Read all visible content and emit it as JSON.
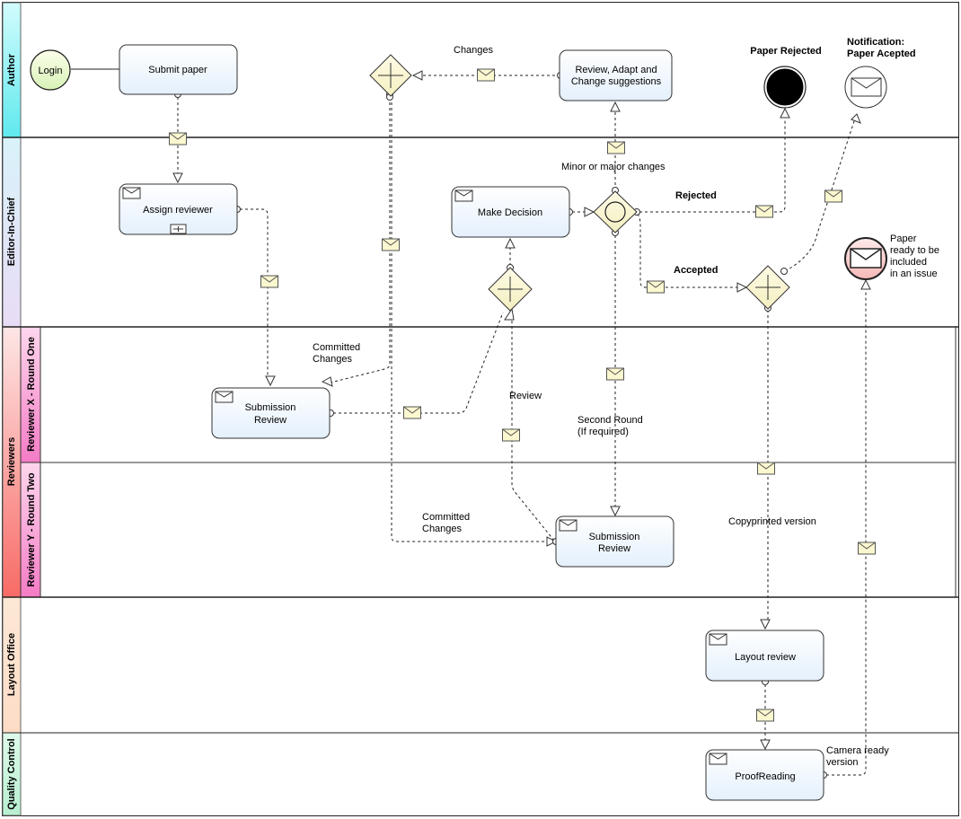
{
  "lanes": {
    "author": "Author",
    "editor": "Editor-In-Chief",
    "reviewers": "Reviewers",
    "reviewer_x": "Reviewer X - Round One",
    "reviewer_y": "Reviewer Y - Round Two",
    "layout": "Layout Office",
    "quality": "Quality Control"
  },
  "lane_colors": {
    "author": "#7ff0f3",
    "editor": "#e6dcf5",
    "reviewers": "#fa7d78",
    "reviewer_sub": "#f78fd0",
    "layout": "#fde3cf",
    "quality": "#c6f5dc"
  },
  "events": {
    "login": "Login",
    "paper_rejected": "Paper Rejected",
    "notification_1": "Notification:",
    "notification_2": "Paper Acepted",
    "ready_1": "Paper",
    "ready_2": "ready to be",
    "ready_3": "included",
    "ready_4": "in an issue"
  },
  "tasks": {
    "submit_paper": "Submit paper",
    "review_adapt_1": "Review, Adapt and",
    "review_adapt_2": "Change suggestions",
    "assign_reviewer": "Assign reviewer",
    "make_decision": "Make Decision",
    "submission_review_1a": "Submission",
    "submission_review_1b": "Review",
    "submission_review_2a": "Submission",
    "submission_review_2b": "Review",
    "layout_review": "Layout review",
    "proofreading": "ProofReading"
  },
  "flow_labels": {
    "changes": "Changes",
    "minor_major": "Minor or major changes",
    "rejected": "Rejected",
    "accepted": "Accepted",
    "committed_1a": "Committed",
    "committed_1b": "Changes",
    "review": "Review",
    "second_round_1": "Second Round",
    "second_round_2": "(If required)",
    "committed_2a": "Committed",
    "committed_2b": "Changes",
    "copyprinted": "Copyprinted version",
    "camera_1": "Camera ready",
    "camera_2": "version"
  }
}
